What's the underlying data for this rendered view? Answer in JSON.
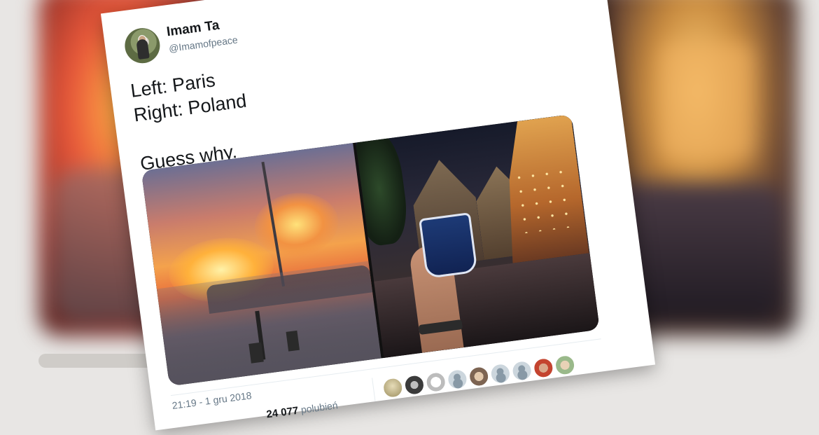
{
  "tweet": {
    "author_name": "Imam Ta",
    "author_handle": "@Imamofpeace",
    "text_lines": [
      "Left: Paris",
      "Right: Poland",
      "",
      "Guess why."
    ],
    "timestamp": "21:19 - 1 gru 2018",
    "likes_count": "24 077",
    "likes_label": "polubień"
  },
  "background": {
    "stamp_text": "21:19 - 1 gru 2018"
  }
}
